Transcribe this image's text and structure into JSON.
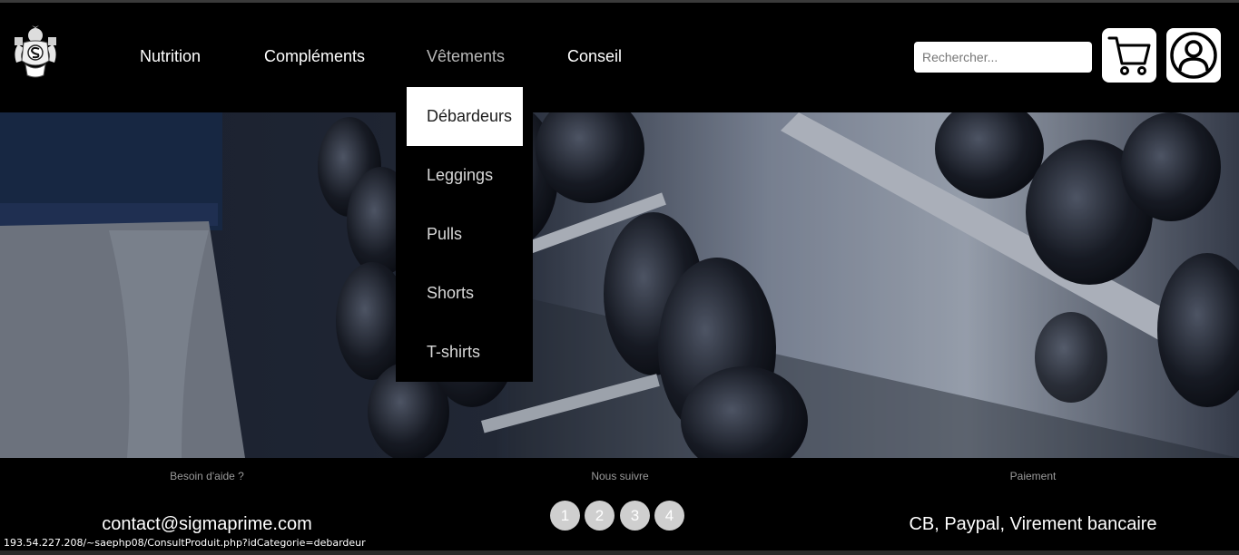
{
  "header": {
    "logo_text": "SP",
    "nav": [
      {
        "label": "Nutrition"
      },
      {
        "label": "Compléments"
      },
      {
        "label": "Vêtements"
      },
      {
        "label": "Conseil"
      }
    ],
    "search": {
      "placeholder": "Rechercher...",
      "value": ""
    },
    "cart_icon": "cart-icon",
    "account_icon": "user-icon"
  },
  "dropdown": {
    "items": [
      {
        "label": "Débardeurs"
      },
      {
        "label": "Leggings"
      },
      {
        "label": "Pulls"
      },
      {
        "label": "Shorts"
      },
      {
        "label": "T-shirts"
      }
    ]
  },
  "footer": {
    "help": {
      "heading": "Besoin d'aide ?",
      "text": "contact@sigmaprime.com"
    },
    "follow": {
      "heading": "Nous suivre",
      "links": [
        "1",
        "2",
        "3",
        "4"
      ]
    },
    "payment": {
      "heading": "Paiement",
      "text": "CB, Paypal, Virement bancaire"
    }
  },
  "status_bar": {
    "url": "193.54.227.208/~saephp08/ConsultProduit.php?idCategorie=debardeur"
  },
  "colors": {
    "background": "#000000",
    "active_nav": "#b9b9b9",
    "dropdown_highlight": "#ffffff"
  }
}
